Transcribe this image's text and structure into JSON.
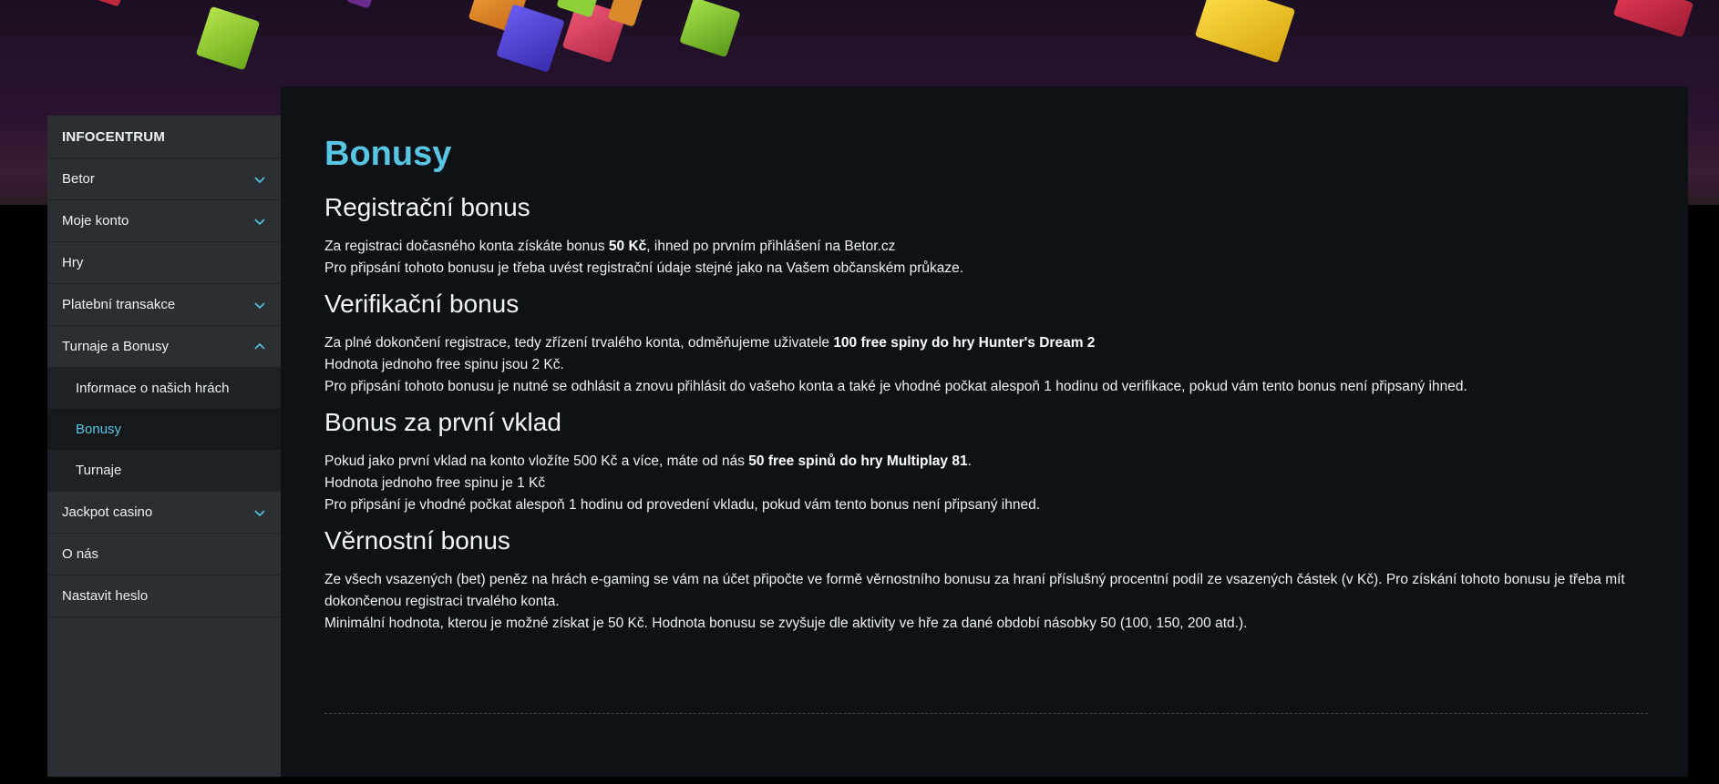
{
  "sidebar": {
    "heading": "INFOCENTRUM",
    "items": [
      {
        "label": "Betor",
        "icon": "chevron-down-icon"
      },
      {
        "label": "Moje konto",
        "icon": "chevron-down-icon"
      },
      {
        "label": "Hry"
      },
      {
        "label": "Platební transakce",
        "icon": "chevron-down-icon"
      },
      {
        "label": "Turnaje a Bonusy",
        "icon": "chevron-up-icon"
      }
    ],
    "subitems": [
      {
        "label": "Informace o našich hrách"
      },
      {
        "label": "Bonusy",
        "active": true
      },
      {
        "label": "Turnaje"
      }
    ],
    "items_after": [
      {
        "label": "Jackpot casino",
        "icon": "chevron-down-icon"
      },
      {
        "label": "O nás"
      },
      {
        "label": "Nastavit heslo"
      }
    ]
  },
  "main": {
    "title": "Bonusy",
    "sections": [
      {
        "heading": "Registrační bonus",
        "p1_pre": "Za registraci dočasného konta získáte bonus ",
        "p1_bold": "50 Kč",
        "p1_post": ", ihned po prvním přihlášení na Betor.cz",
        "p2": "Pro připsání tohoto bonusu je třeba uvést registrační údaje stejné jako na Vašem občanském průkaze."
      },
      {
        "heading": "Verifikační bonus",
        "p1_pre": "Za plné dokončení registrace, tedy zřízení trvalého konta, odměňujeme uživatele ",
        "p1_bold": "100 free spiny do hry Hunter's Dream 2",
        "p2": "Hodnota jednoho free spinu jsou 2 Kč.",
        "p3": "Pro připsání tohoto bonusu je nutné se odhlásit a znovu přihlásit do vašeho konta a také je vhodné počkat alespoň 1 hodinu od verifikace, pokud vám tento bonus není připsaný ihned."
      },
      {
        "heading": "Bonus za první vklad",
        "p1_pre": "Pokud jako první vklad na konto vložíte 500 Kč a více, máte od nás ",
        "p1_bold": "50 free spinů do hry Multiplay 81",
        "p1_post": ".",
        "p2": "Hodnota jednoho free spinu je 1 Kč",
        "p3": "Pro připsání je vhodné počkat alespoň 1 hodinu od provedení vkladu, pokud vám tento bonus není připsaný ihned."
      },
      {
        "heading": "Věrnostní bonus",
        "p1": "Ze všech vsazených (bet) peněz na hrách e-gaming se vám na účet připočte ve formě věrnostního bonusu za hraní příslušný procentní podíl ze vsazených částek (v Kč). Pro získání tohoto bonusu je třeba mít dokončenou registraci trvalého konta.",
        "p2": "Minimální hodnota, kterou je možné získat je 50 Kč. Hodnota bonusu se zvyšuje dle aktivity ve hře za dané období násobky 50 (100, 150, 200 atd.)."
      }
    ]
  },
  "colors": {
    "accent": "#58c5e2",
    "sidebar_bg": "#2b2f34",
    "content_bg": "#0e1115"
  }
}
